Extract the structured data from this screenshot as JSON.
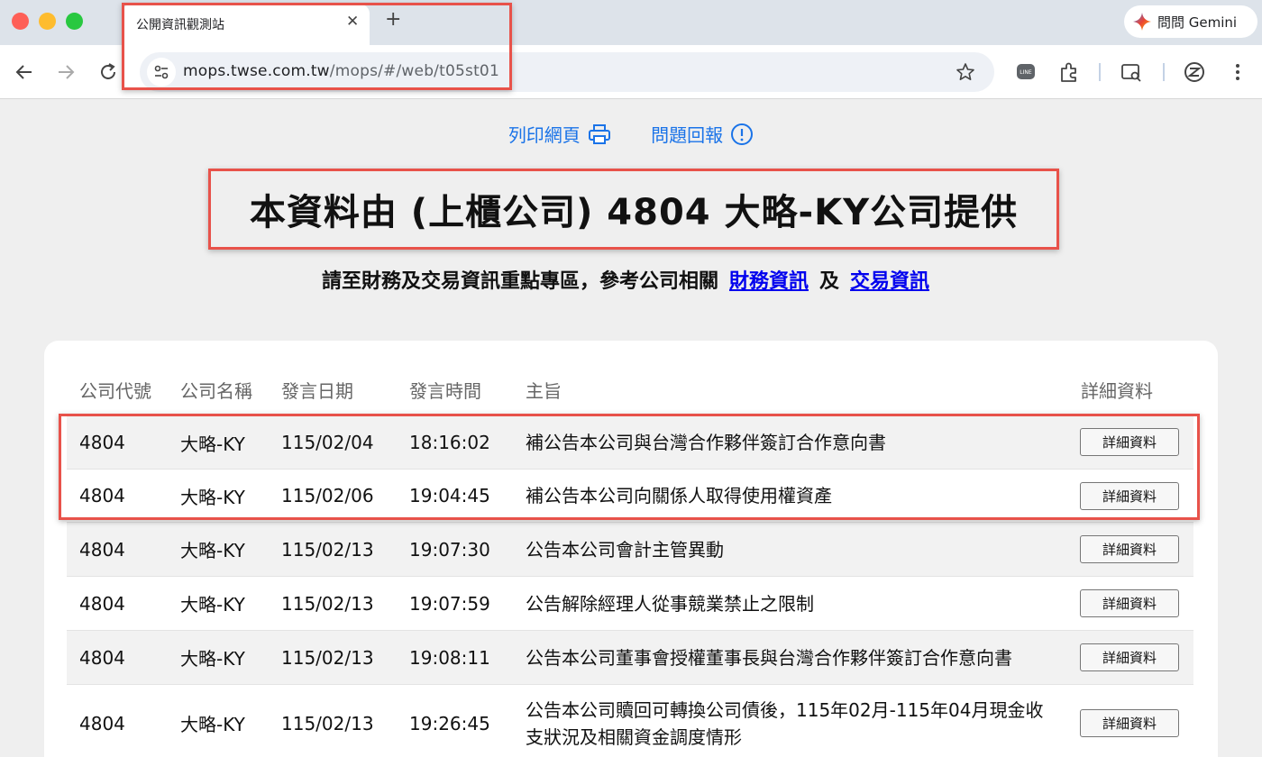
{
  "browser": {
    "tab_title": "公開資訊觀測站",
    "new_tab": "+",
    "close": "✕",
    "gemini_label": "問問 Gemini",
    "url_host": "mops.twse.com.tw",
    "url_path": "/mops/#/web/t05st01"
  },
  "utility": {
    "print_label": "列印網頁",
    "report_label": "問題回報"
  },
  "heading": "本資料由 (上櫃公司) 4804 大略-KY公司提供",
  "subline": {
    "text": "請至財務及交易資訊重點專區，參考公司相關",
    "finance_link": "財務資訊",
    "and": "及",
    "trade_link": "交易資訊"
  },
  "table": {
    "headers": [
      "公司代號",
      "公司名稱",
      "發言日期",
      "發言時間",
      "主旨",
      "詳細資料"
    ],
    "button_label": "詳細資料",
    "rows": [
      {
        "code": "4804",
        "name": "大略-KY",
        "date": "115/02/04",
        "time": "18:16:02",
        "subject": "補公告本公司與台灣合作夥伴簽訂合作意向書"
      },
      {
        "code": "4804",
        "name": "大略-KY",
        "date": "115/02/06",
        "time": "19:04:45",
        "subject": "補公告本公司向關係人取得使用權資產"
      },
      {
        "code": "4804",
        "name": "大略-KY",
        "date": "115/02/13",
        "time": "19:07:30",
        "subject": "公告本公司會計主管異動"
      },
      {
        "code": "4804",
        "name": "大略-KY",
        "date": "115/02/13",
        "time": "19:07:59",
        "subject": "公告解除經理人從事競業禁止之限制"
      },
      {
        "code": "4804",
        "name": "大略-KY",
        "date": "115/02/13",
        "time": "19:08:11",
        "subject": "公告本公司董事會授權董事長與台灣合作夥伴簽訂合作意向書"
      },
      {
        "code": "4804",
        "name": "大略-KY",
        "date": "115/02/13",
        "time": "19:26:45",
        "subject": "公告本公司贖回可轉換公司債後，115年02月-115年04月現金收支狀況及相關資金調度情形"
      }
    ]
  },
  "colors": {
    "link": "#1a73e8",
    "hyperlink": "#0000ee",
    "annotation": "#e8524a"
  }
}
